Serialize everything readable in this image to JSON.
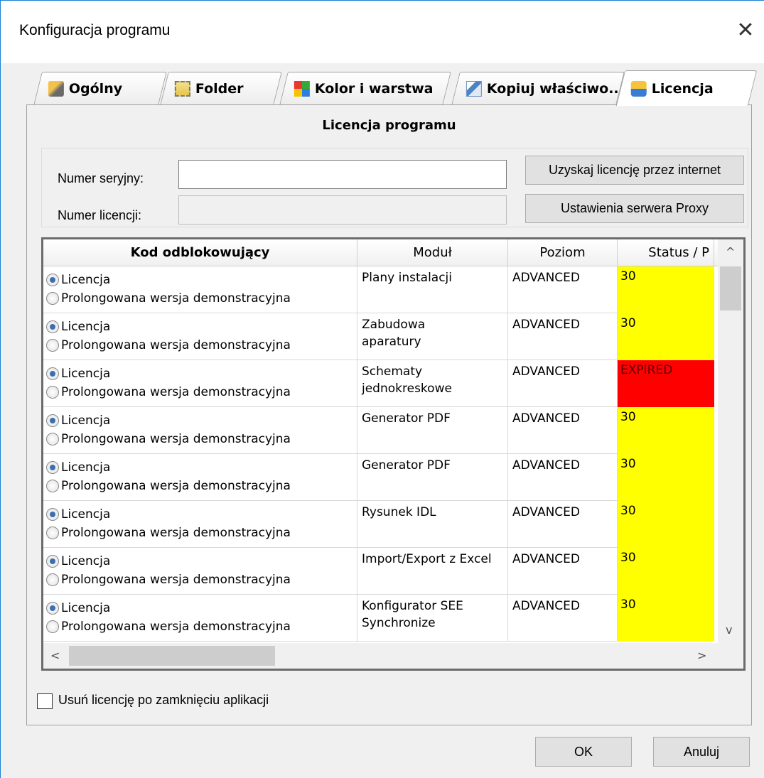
{
  "window": {
    "title": "Konfiguracja programu",
    "close_glyph": "✕"
  },
  "tabs": [
    {
      "label": "Ogólny",
      "icon": "tools-icon",
      "active": false
    },
    {
      "label": "Folder",
      "icon": "folder-tree-icon",
      "active": false
    },
    {
      "label": "Kolor i warstwa",
      "icon": "color-grid-icon",
      "active": false
    },
    {
      "label": "Kopiuj właściwo...",
      "icon": "copy-properties-icon",
      "active": false
    },
    {
      "label": "Licencja",
      "icon": "license-key-icon",
      "active": true
    }
  ],
  "license": {
    "section_title": "Licencja programu",
    "serial_label": "Numer seryjny:",
    "serial_value": "",
    "license_label": "Numer licencji:",
    "license_value": "",
    "get_license_button": "Uzyskaj licencję przez internet",
    "proxy_button": "Ustawienia serwera Proxy"
  },
  "table": {
    "columns": [
      "Kod odblokowujący",
      "Moduł",
      "Poziom",
      "Status / P"
    ],
    "radio_options": [
      "Licencja",
      "Prolongowana wersja demonstracyjna"
    ],
    "rows": [
      {
        "module": "Plany instalacji",
        "level": "ADVANCED",
        "status": "30",
        "status_color": "#ffff00"
      },
      {
        "module": "Zabudowa\naparatury",
        "level": "ADVANCED",
        "status": "30",
        "status_color": "#ffff00"
      },
      {
        "module": "Schematy\njednokreskowe",
        "level": "ADVANCED",
        "status": "EXPIRED",
        "status_color": "#ff0000"
      },
      {
        "module": "Generator PDF",
        "level": "ADVANCED",
        "status": "30",
        "status_color": "#ffff00"
      },
      {
        "module": "Generator PDF",
        "level": "ADVANCED",
        "status": "30",
        "status_color": "#ffff00"
      },
      {
        "module": "Rysunek IDL",
        "level": "ADVANCED",
        "status": "30",
        "status_color": "#ffff00"
      },
      {
        "module": "Import/Export z Excel",
        "level": "ADVANCED",
        "status": "30",
        "status_color": "#ffff00"
      },
      {
        "module": "Konfigurator SEE\nSynchronize",
        "level": "ADVANCED",
        "status": "30",
        "status_color": "#ffff00"
      }
    ]
  },
  "scroll": {
    "up": "^",
    "down": "v",
    "left": "<",
    "right": ">"
  },
  "delete_license_checkbox": {
    "label": "Usuń licencję po zamknięciu aplikacji",
    "checked": false
  },
  "footer": {
    "ok": "OK",
    "cancel": "Anuluj"
  }
}
